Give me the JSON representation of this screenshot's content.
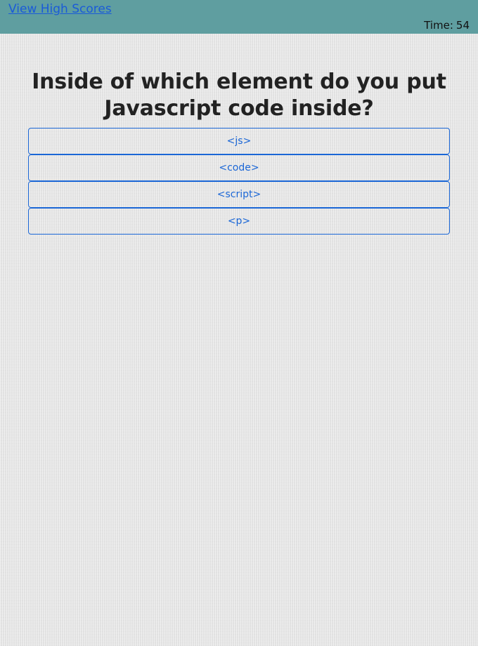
{
  "header": {
    "high_scores_link": "View High Scores",
    "timer_label": "Time:",
    "timer_value": "54"
  },
  "quiz": {
    "question": "Inside of which element do you put Javascript code inside?",
    "answers": [
      "<js>",
      "<code>",
      "<script>",
      "<p>"
    ]
  },
  "colors": {
    "header_bg": "#5f9ea0",
    "link": "#1a5bd8",
    "button_accent": "#1a66d6",
    "page_bg": "#e8e8e8"
  }
}
